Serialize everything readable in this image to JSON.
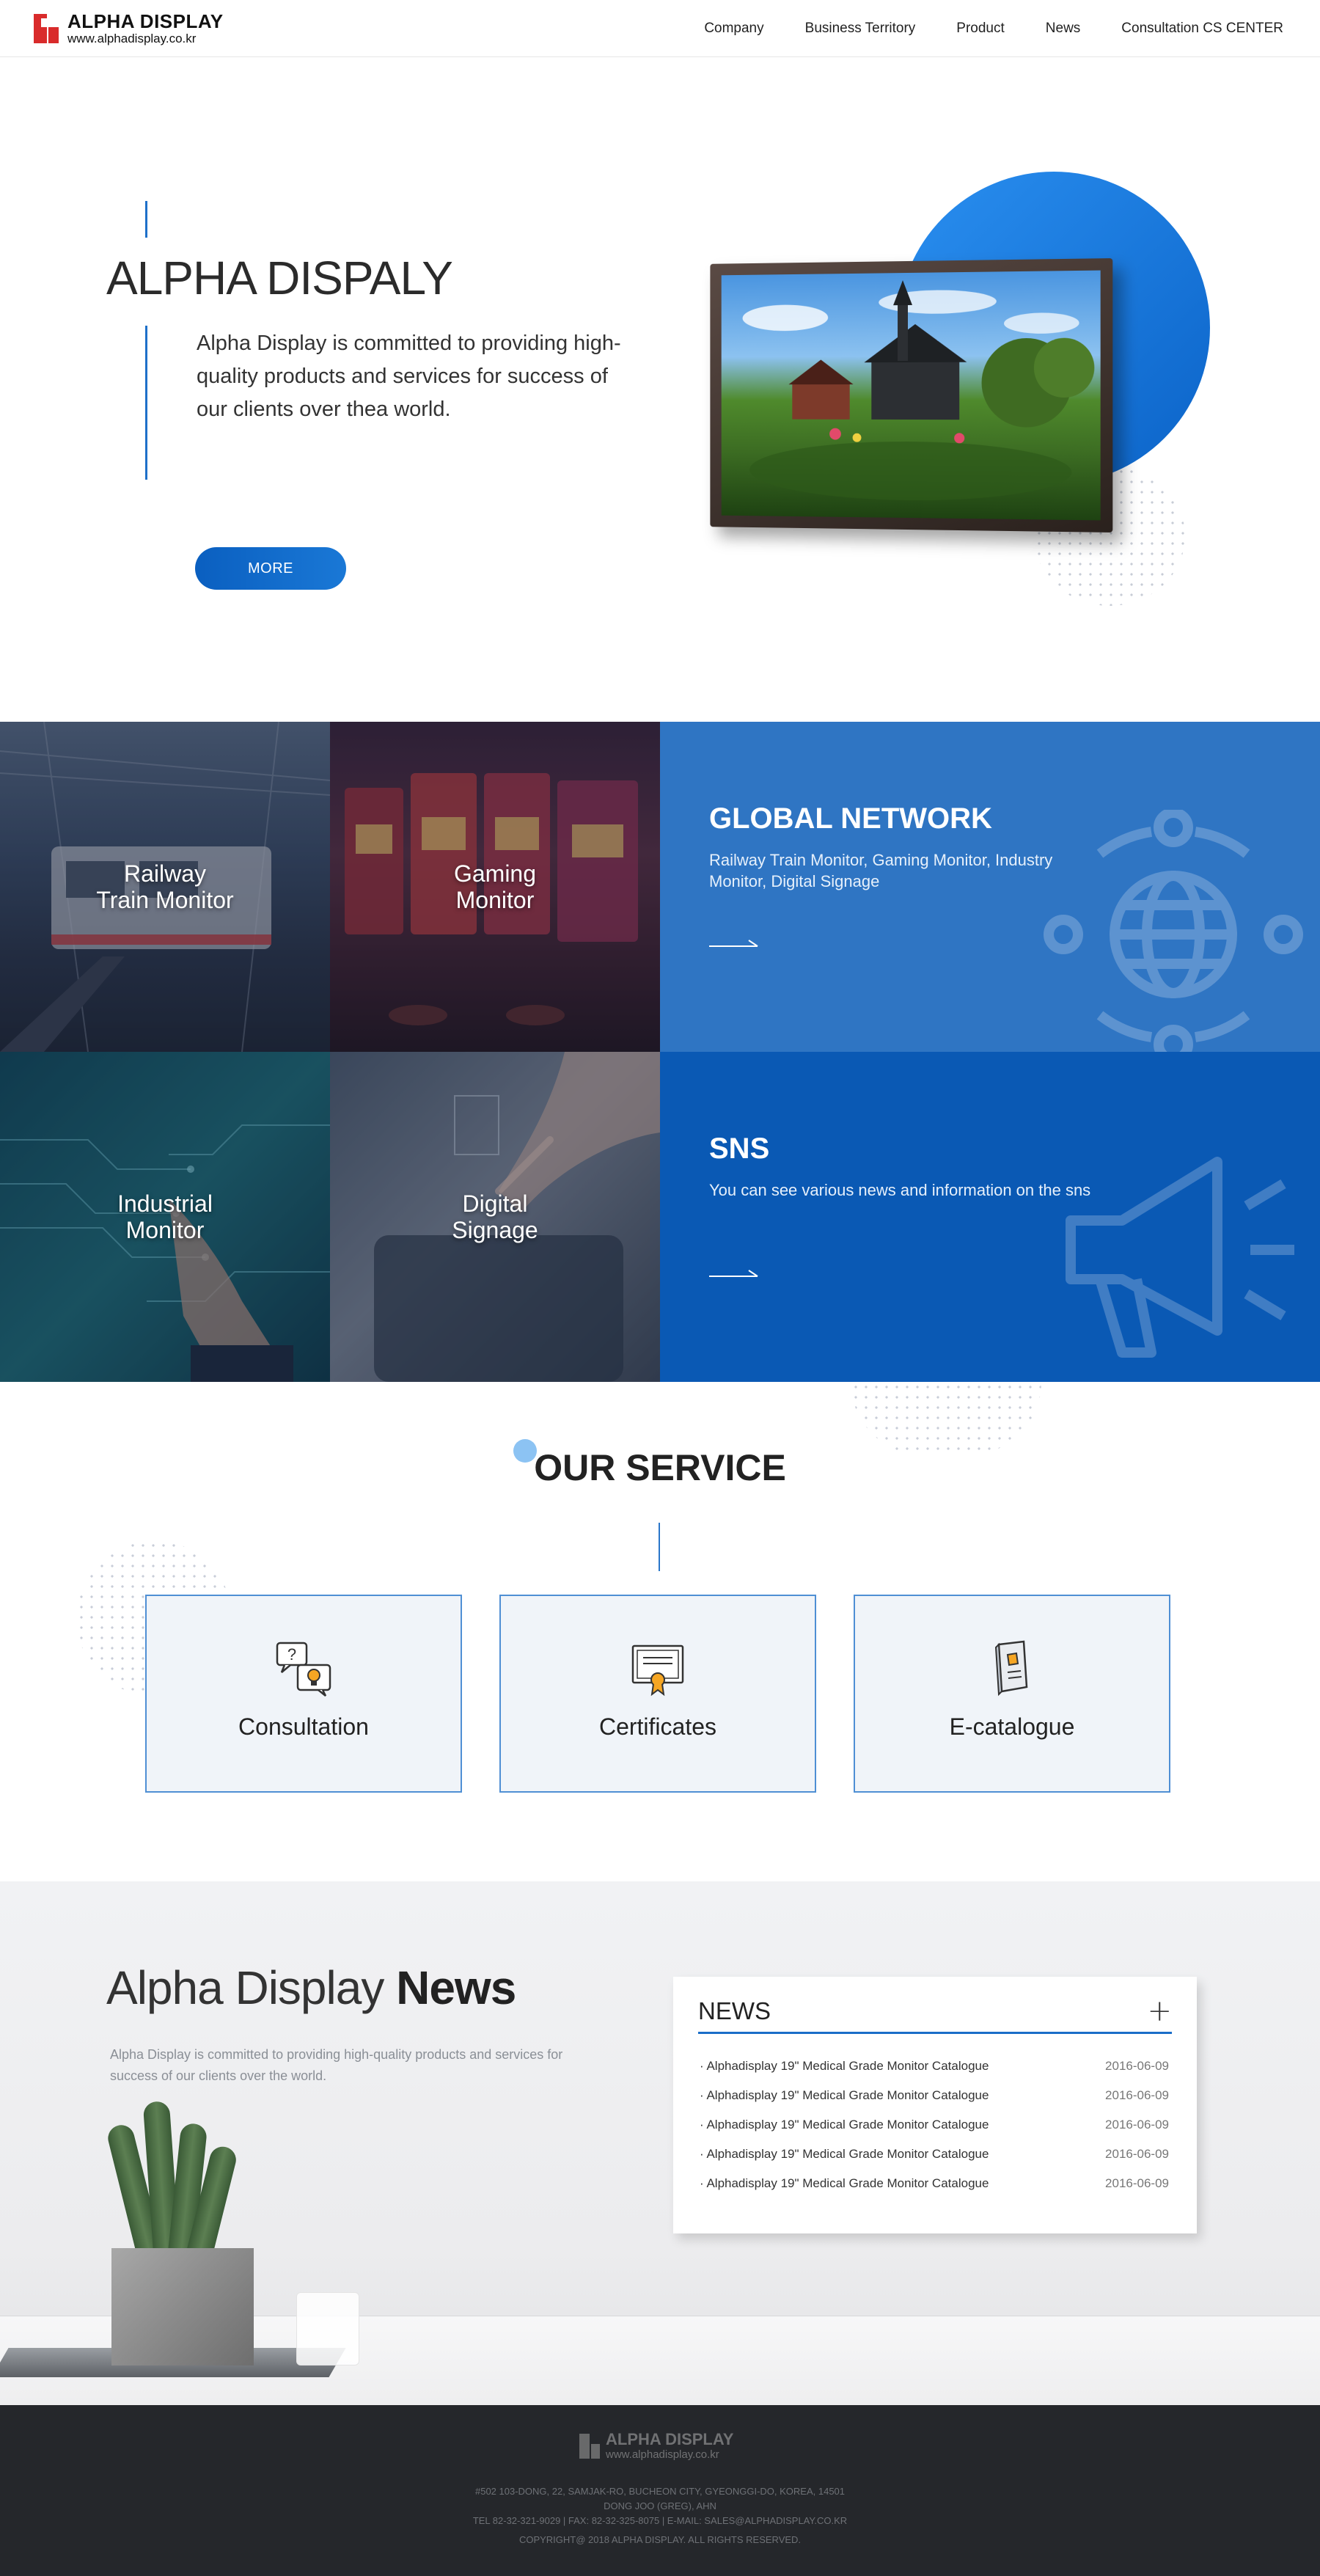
{
  "header": {
    "logo_name": "ALPHA DISPLAY",
    "logo_url": "www.alphadisplay.co.kr",
    "nav": [
      {
        "label": "Company"
      },
      {
        "label": "Business Territory"
      },
      {
        "label": "Product"
      },
      {
        "label": "News"
      },
      {
        "label": "Consultation CS CENTER"
      }
    ]
  },
  "hero": {
    "title": "ALPHA DISPALY",
    "description": "Alpha Display is committed to providing high-quality products and services for success of our clients over thea world.",
    "more_label": "MORE",
    "accent": "#1e70c9"
  },
  "tiles": {
    "railway": "Railway\nTrain Monitor",
    "gaming": "Gaming\nMonitor",
    "industrial": "Industrial\nMonitor",
    "digital": "Digital\nSignage"
  },
  "global_network": {
    "title": "GLOBAL NETWORK",
    "description": "Railway Train Monitor, Gaming Monitor, Industry Monitor, Digital Signage",
    "icon": "globe-network-icon",
    "color": "#2f75c3"
  },
  "sns": {
    "title": "SNS",
    "description": "You can see various news and information on the sns",
    "icon": "megaphone-icon",
    "color": "#0a59b4"
  },
  "service": {
    "title": "OUR SERVICE",
    "cards": [
      {
        "label": "Consultation",
        "icon": "consultation-icon"
      },
      {
        "label": "Certificates",
        "icon": "certificate-icon"
      },
      {
        "label": "E-catalogue",
        "icon": "catalogue-icon"
      }
    ]
  },
  "news_section": {
    "title_light": "Alpha Display",
    "title_bold": "News",
    "description": "Alpha Display is committed to providing high-quality products and services for success of our clients over the world.",
    "box_title": "NEWS",
    "more_icon": "plus-icon",
    "items": [
      {
        "title": "Alphadisplay 19\" Medical Grade Monitor Catalogue",
        "date": "2016-06-09"
      },
      {
        "title": "Alphadisplay 19\" Medical Grade Monitor Catalogue",
        "date": "2016-06-09"
      },
      {
        "title": "Alphadisplay 19\" Medical Grade Monitor Catalogue",
        "date": "2016-06-09"
      },
      {
        "title": "Alphadisplay 19\" Medical Grade Monitor Catalogue",
        "date": "2016-06-09"
      },
      {
        "title": "Alphadisplay 19\" Medical Grade Monitor Catalogue",
        "date": "2016-06-09"
      }
    ]
  },
  "footer": {
    "logo_name": "ALPHA DISPLAY",
    "logo_url": "www.alphadisplay.co.kr",
    "address": "#502 103-DONG, 22, SAMJAK-RO, BUCHEON CITY, GYEONGGI-DO, KOREA, 14501",
    "ceo": "DONG JOO (GREG), AHN",
    "contact": "TEL 82-32-321-9029 | FAX: 82-32-325-8075 | E-MAIL: SALES@ALPHADISPLAY.CO.KR",
    "copyright": "COPYRIGHT@ 2018 ALPHA DISPLAY. ALL RIGHTS RESERVED."
  }
}
